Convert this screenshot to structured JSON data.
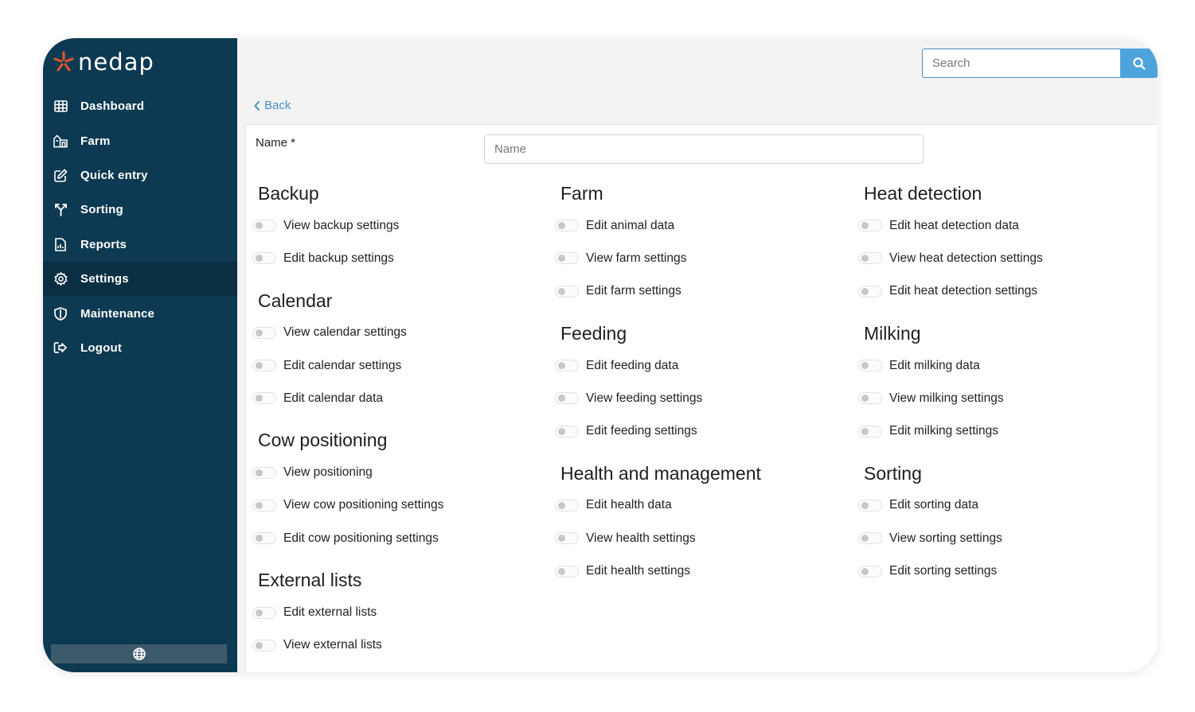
{
  "brand": {
    "name": "nedap",
    "accent": "#e8552b",
    "sidebar_bg": "#0d3a52"
  },
  "sidebar": {
    "items": [
      {
        "label": "Dashboard",
        "icon": "grid-icon",
        "active": false
      },
      {
        "label": "Farm",
        "icon": "farm-icon",
        "active": false
      },
      {
        "label": "Quick entry",
        "icon": "edit-icon",
        "active": false
      },
      {
        "label": "Sorting",
        "icon": "sorting-icon",
        "active": false
      },
      {
        "label": "Reports",
        "icon": "report-icon",
        "active": false
      },
      {
        "label": "Settings",
        "icon": "gear-icon",
        "active": true
      },
      {
        "label": "Maintenance",
        "icon": "shield-icon",
        "active": false
      },
      {
        "label": "Logout",
        "icon": "logout-icon",
        "active": false
      }
    ],
    "language_icon": "globe-icon"
  },
  "header": {
    "search_placeholder": "Search",
    "back_label": "Back"
  },
  "form": {
    "name_label": "Name *",
    "name_placeholder": "Name"
  },
  "columns": [
    [
      {
        "title": "Backup",
        "permissions": [
          "View backup settings",
          "Edit backup settings"
        ]
      },
      {
        "title": "Calendar",
        "permissions": [
          "View calendar settings",
          "Edit calendar settings",
          "Edit calendar data"
        ]
      },
      {
        "title": "Cow positioning",
        "permissions": [
          "View positioning",
          "View cow positioning settings",
          "Edit cow positioning settings"
        ]
      },
      {
        "title": "External lists",
        "permissions": [
          "Edit external lists",
          "View external lists"
        ]
      }
    ],
    [
      {
        "title": "Farm",
        "permissions": [
          "Edit animal data",
          "View farm settings",
          "Edit farm settings"
        ]
      },
      {
        "title": "Feeding",
        "permissions": [
          "Edit feeding data",
          "View feeding settings",
          "Edit feeding settings"
        ]
      },
      {
        "title": "Health and management",
        "permissions": [
          "Edit health data",
          "View health settings",
          "Edit health settings"
        ]
      }
    ],
    [
      {
        "title": "Heat detection",
        "permissions": [
          "Edit heat detection data",
          "View heat detection settings",
          "Edit heat detection settings"
        ]
      },
      {
        "title": "Milking",
        "permissions": [
          "Edit milking data",
          "View milking settings",
          "Edit milking settings"
        ]
      },
      {
        "title": "Sorting",
        "permissions": [
          "Edit sorting data",
          "View sorting settings",
          "Edit sorting settings"
        ]
      }
    ]
  ]
}
